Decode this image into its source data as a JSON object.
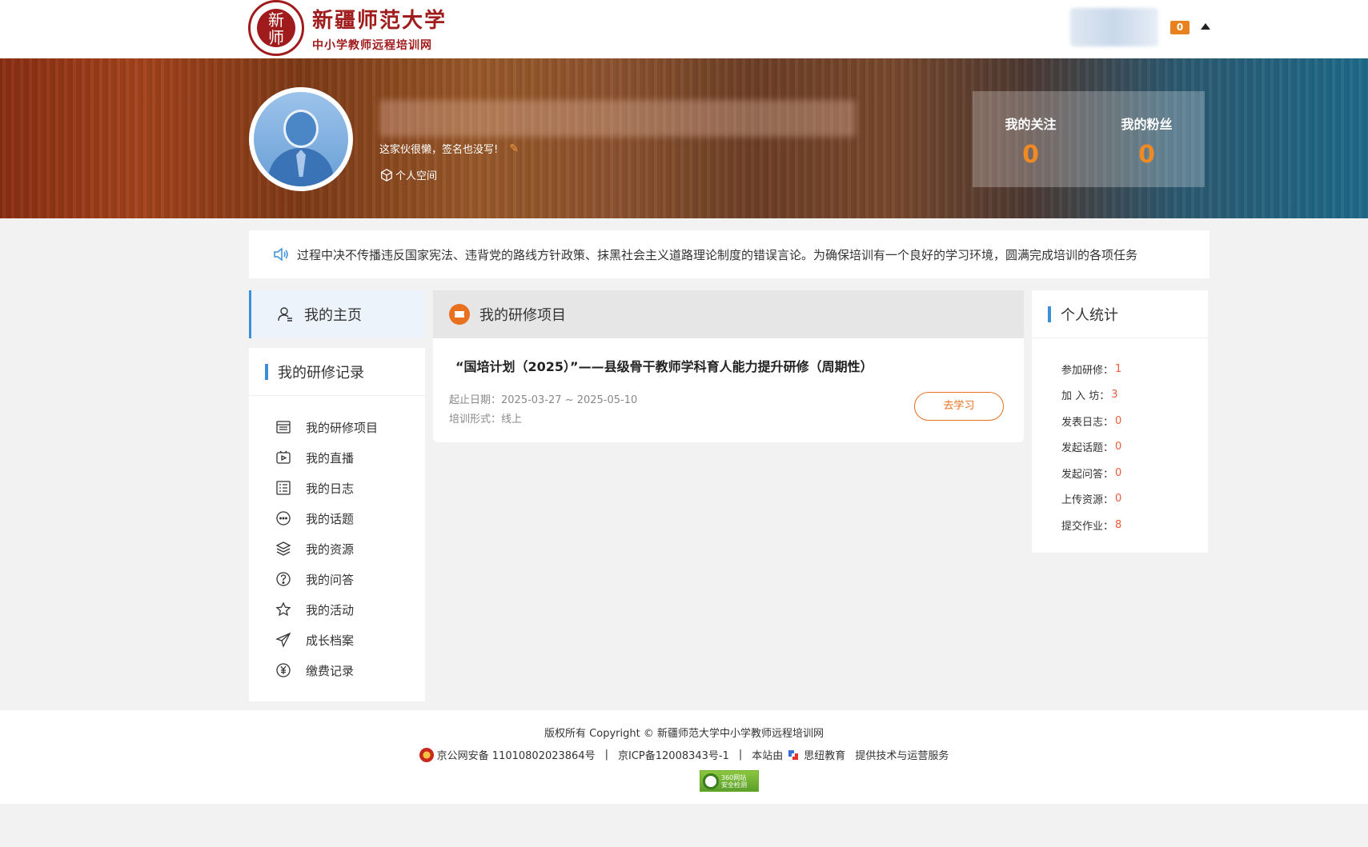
{
  "header": {
    "logo_seal_top": "新",
    "logo_seal_bottom": "师",
    "university_name": "新疆师范大学",
    "site_name": "中小学教师远程培训网",
    "message_count": "0"
  },
  "profile": {
    "signature": "这家伙很懒，签名也没写!",
    "space_link": "个人空间",
    "following_label": "我的关注",
    "following_count": "0",
    "fans_label": "我的粉丝",
    "fans_count": "0"
  },
  "notice": {
    "text": "过程中决不传播违反国家宪法、违背党的路线方针政策、抹黑社会主义道路理论制度的错误言论。为确保培训有一个良好的学习环境，圆满完成培训的各项任务"
  },
  "sidebar": {
    "home_label": "我的主页",
    "records_title": "我的研修记录",
    "items": [
      {
        "label": "我的研修项目",
        "icon": "list-doc-icon"
      },
      {
        "label": "我的直播",
        "icon": "live-tv-icon"
      },
      {
        "label": "我的日志",
        "icon": "log-list-icon"
      },
      {
        "label": "我的话题",
        "icon": "chat-bubble-icon"
      },
      {
        "label": "我的资源",
        "icon": "layers-icon"
      },
      {
        "label": "我的问答",
        "icon": "question-icon"
      },
      {
        "label": "我的活动",
        "icon": "star-icon"
      },
      {
        "label": "成长档案",
        "icon": "send-plane-icon"
      },
      {
        "label": "缴费记录",
        "icon": "yen-icon"
      }
    ]
  },
  "projects": {
    "section_title": "我的研修项目",
    "items": [
      {
        "title": "“国培计划（2025）”——县级骨干教师学科育人能力提升研修（周期性）",
        "date_label": "起止日期：",
        "date_value": "2025-03-27 ~ 2025-05-10",
        "form_label": "培训形式：",
        "form_value": "线上",
        "action_label": "去学习"
      }
    ]
  },
  "stats": {
    "title": "个人统计",
    "rows": [
      {
        "label": "参加研修：",
        "value": "1"
      },
      {
        "label": "加 入 坊：",
        "value": "3"
      },
      {
        "label": "发表日志：",
        "value": "0"
      },
      {
        "label": "发起话题：",
        "value": "0"
      },
      {
        "label": "发起问答：",
        "value": "0"
      },
      {
        "label": "上传资源：",
        "value": "0"
      },
      {
        "label": "提交作业：",
        "value": "8"
      }
    ]
  },
  "footer": {
    "copyright": "版权所有 Copyright © 新疆师范大学中小学教师远程培训网",
    "police_record": "京公网安备 11010802023864号",
    "sep1": "|",
    "icp": "京ICP备12008343号-1",
    "sep2": "|",
    "site_by": "本站由",
    "company": "思纽教育",
    "service": "提供技术与运营服务",
    "badge_line1": "360网站",
    "badge_line2": "安全检测"
  },
  "colors": {
    "accent_orange": "#e8701e",
    "accent_blue": "#3b8fd8",
    "stat_value": "#f05a3a",
    "brand_red": "#a01c1c"
  }
}
